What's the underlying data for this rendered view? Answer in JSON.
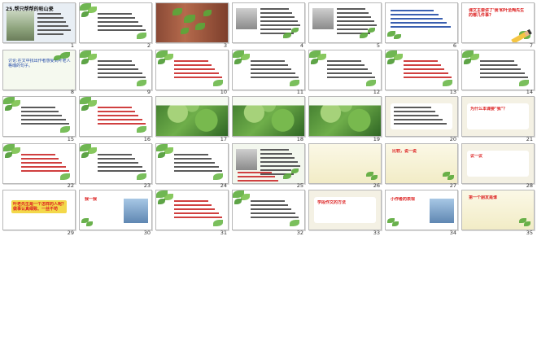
{
  "view": "slide-sorter",
  "slides": [
    {
      "n": "1",
      "title": "25.帮只帮帮的帕山瓷",
      "kind": "cover"
    },
    {
      "n": "2",
      "kind": "leaves-text"
    },
    {
      "n": "3",
      "kind": "ivy-photo"
    },
    {
      "n": "4",
      "kind": "portrait-text"
    },
    {
      "n": "5",
      "kind": "portrait-text"
    },
    {
      "n": "6",
      "kind": "word-grid"
    },
    {
      "n": "7",
      "text": "课文主要讲了'我'和叶圣陶先生的哪几件事?",
      "kind": "question"
    },
    {
      "n": "8",
      "text": "讨论:在文中找出作者感受到叶老人格魂的句子。",
      "kind": "discussion"
    },
    {
      "n": "9",
      "kind": "leaves-text"
    },
    {
      "n": "10",
      "kind": "leaves-text"
    },
    {
      "n": "11",
      "kind": "leaves-text"
    },
    {
      "n": "12",
      "kind": "leaves-text"
    },
    {
      "n": "13",
      "kind": "leaves-text"
    },
    {
      "n": "14",
      "kind": "leaves-text"
    },
    {
      "n": "15",
      "kind": "leaves-text"
    },
    {
      "n": "16",
      "kind": "leaves-text"
    },
    {
      "n": "17",
      "kind": "ivy-photo"
    },
    {
      "n": "18",
      "kind": "ivy-photo"
    },
    {
      "n": "19",
      "kind": "ivy-photo"
    },
    {
      "n": "20",
      "kind": "framed-text"
    },
    {
      "n": "21",
      "text": "为什么本课要\"我\"？",
      "kind": "framed-text"
    },
    {
      "n": "22",
      "kind": "leaves-text"
    },
    {
      "n": "23",
      "kind": "leaves-text"
    },
    {
      "n": "24",
      "kind": "leaves-text"
    },
    {
      "n": "25",
      "kind": "portrait-text"
    },
    {
      "n": "26",
      "kind": "question"
    },
    {
      "n": "27",
      "text": "比较，说一说",
      "kind": "question"
    },
    {
      "n": "28",
      "text": "议一议",
      "kind": "framed-text"
    },
    {
      "n": "29",
      "text": "叶老先生是一个怎样的人呢？ 做事认真细致、一丝不苟",
      "kind": "summary"
    },
    {
      "n": "30",
      "text": "我一我",
      "kind": "photo-text"
    },
    {
      "n": "31",
      "kind": "leaves-text"
    },
    {
      "n": "32",
      "kind": "leaves-text"
    },
    {
      "n": "33",
      "text": "学段作文的方法",
      "kind": "framed-text"
    },
    {
      "n": "34",
      "text": "小作者的表现",
      "kind": "photo-text"
    },
    {
      "n": "35",
      "text": "第一个朋友是谁",
      "kind": "question"
    }
  ]
}
